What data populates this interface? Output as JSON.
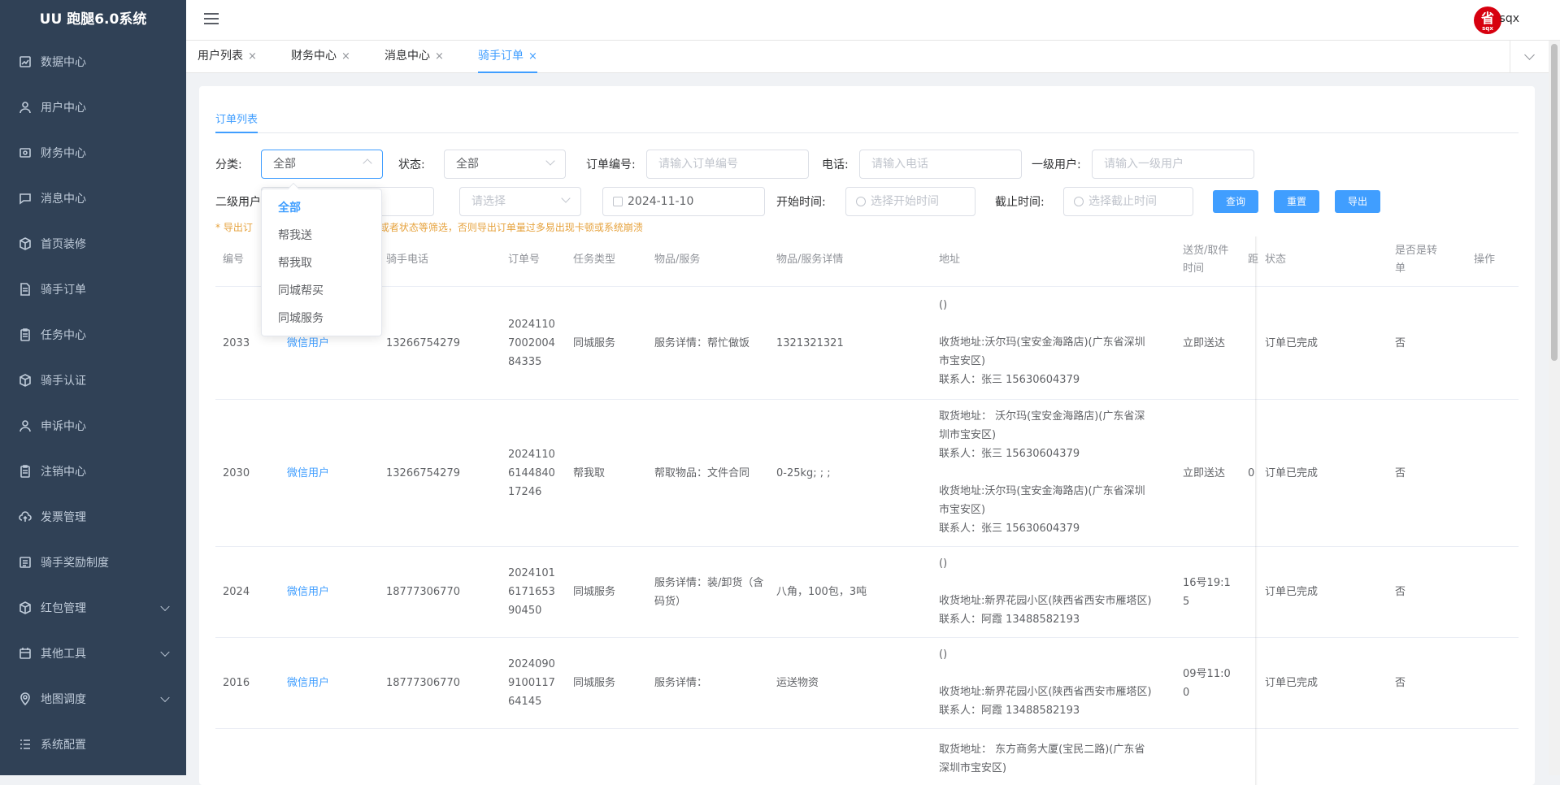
{
  "app": {
    "title": "UU 跑腿6.0系统"
  },
  "sidebar": {
    "items": [
      {
        "label": "数据中心",
        "icon": "chart-icon"
      },
      {
        "label": "用户中心",
        "icon": "user-icon"
      },
      {
        "label": "财务中心",
        "icon": "wallet-icon"
      },
      {
        "label": "消息中心",
        "icon": "message-icon"
      },
      {
        "label": "首页装修",
        "icon": "cube-icon"
      },
      {
        "label": "骑手订单",
        "icon": "document-icon"
      },
      {
        "label": "任务中心",
        "icon": "clipboard-icon"
      },
      {
        "label": "骑手认证",
        "icon": "cube-icon"
      },
      {
        "label": "申诉中心",
        "icon": "user-icon"
      },
      {
        "label": "注销中心",
        "icon": "clipboard-icon"
      },
      {
        "label": "发票管理",
        "icon": "cloud-upload-icon"
      },
      {
        "label": "骑手奖励制度",
        "icon": "list-icon"
      },
      {
        "label": "红包管理",
        "icon": "cube-icon"
      },
      {
        "label": "其他工具",
        "icon": "calendar-icon"
      },
      {
        "label": "地图调度",
        "icon": "location-icon"
      },
      {
        "label": "系统配置",
        "icon": "settings-list-icon"
      }
    ]
  },
  "header": {
    "user": "sqx",
    "avatar_text": "省",
    "avatar_sub": "sqx"
  },
  "tabs": [
    {
      "label": "用户列表"
    },
    {
      "label": "财务中心"
    },
    {
      "label": "消息中心"
    },
    {
      "label": "骑手订单"
    }
  ],
  "tab_close": "×",
  "main": {
    "subtab": "订单列表",
    "filters": {
      "category_label": "分类:",
      "category_value": "全部",
      "status_label": "状态:",
      "status_value": "全部",
      "order_no_label": "订单编号:",
      "order_no_placeholder": "请输入订单编号",
      "phone_label": "电话:",
      "phone_placeholder": "请输入电话",
      "level1_label": "一级用户:",
      "level1_placeholder": "请输入一级用户",
      "level2_label": "二级用户",
      "select_placeholder": "请选择",
      "date_value": "2024-11-10",
      "start_label": "开始时间:",
      "start_placeholder": "选择开始时间",
      "end_label": "截止时间:",
      "end_placeholder": "选择截止时间"
    },
    "buttons": {
      "query": "查询",
      "reset": "重置",
      "export": "导出"
    },
    "warning_prefix": "* 导出订",
    "warning_suffix": "行时间或者状态等筛选，否则导出订单量过多易出现卡顿或系统崩溃",
    "dropdown": [
      "全部",
      "帮我送",
      "帮我取",
      "同城帮买",
      "同城服务"
    ],
    "table": {
      "headers": [
        "编号",
        "骑手电话",
        "订单号",
        "任务类型",
        "物品/服务",
        "物品/服务详情",
        "地址",
        "送货/取件时间",
        "距",
        "状态",
        "是否是转单",
        "操作"
      ],
      "rows": [
        {
          "id": "2033",
          "user": "微信用户",
          "phone": "13266754279",
          "order": "202411070020048 4335",
          "order_lines": [
            "2024110",
            "7002004",
            "84335"
          ],
          "type": "同城服务",
          "item": "服务详情：帮忙做饭",
          "detail": "1321321321",
          "addr": [
            "()",
            "",
            "收货地址:沃尔玛(宝安金海路店)(广东省深圳",
            "市宝安区)",
            "联系人：张三 15630604379"
          ],
          "time": [
            "立即送达"
          ],
          "dist": "",
          "status": "订单已完成",
          "transfer": "否"
        },
        {
          "id": "2030",
          "user": "微信用户",
          "phone": "13266754279",
          "order_lines": [
            "2024110",
            "6144840",
            "17246"
          ],
          "type": "帮我取",
          "item": "帮取物品：文件合同",
          "detail": "0-25kg; ; ;",
          "addr": [
            "取货地址： 沃尔玛(宝安金海路店)(广东省深",
            "圳市宝安区)",
            "联系人：张三 15630604379",
            "",
            "收货地址:沃尔玛(宝安金海路店)(广东省深圳",
            "市宝安区)",
            "联系人：张三 15630604379"
          ],
          "time": [
            "立即送达"
          ],
          "dist": "0",
          "status": "订单已完成",
          "transfer": "否"
        },
        {
          "id": "2024",
          "user": "微信用户",
          "phone": "18777306770",
          "order_lines": [
            "2024101",
            "6171653",
            "90450"
          ],
          "type": "同城服务",
          "item": "服务详情：装/卸货（含码货）",
          "detail": "八角，100包，3吨",
          "addr": [
            "()",
            "",
            "收货地址:新界花园小区(陕西省西安市雁塔区)",
            "联系人：阿霞 13488582193"
          ],
          "time": [
            "16号19:1",
            "5"
          ],
          "dist": "",
          "status": "订单已完成",
          "transfer": "否"
        },
        {
          "id": "2016",
          "user": "微信用户",
          "phone": "18777306770",
          "order_lines": [
            "2024090",
            "9100117",
            "64145"
          ],
          "type": "同城服务",
          "item": "服务详情：",
          "detail": "运送物资",
          "addr": [
            "()",
            "",
            "收货地址:新界花园小区(陕西省西安市雁塔区)",
            "联系人：阿霞 13488582193"
          ],
          "time": [
            "09号11:0",
            "0"
          ],
          "dist": "",
          "status": "订单已完成",
          "transfer": "否"
        }
      ],
      "partial_row_addr": [
        "取货地址： 东方商务大厦(宝民二路)(广东省",
        "深圳市宝安区)"
      ]
    }
  }
}
